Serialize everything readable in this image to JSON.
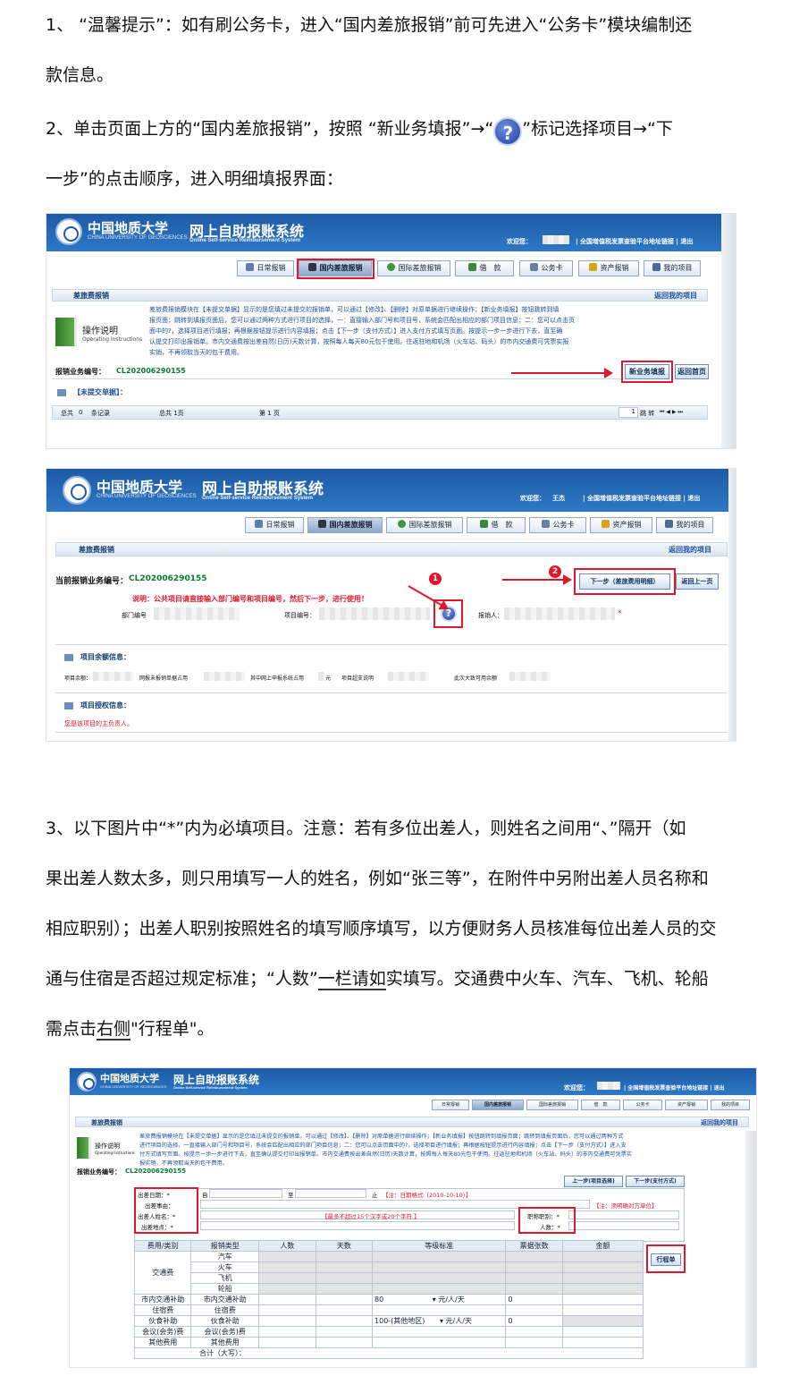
{
  "paragraphs": {
    "p1_line1": "1、  “温馨提示”：如有刷公务卡，进入“国内差旅报销”前可先进入“公务卡”模块编制还",
    "p1_line2": "款信息。",
    "p2_part1": "2、单击页面上方的“国内差旅报销”，按照  “新业务填报”→“",
    "p2_icon": "?",
    "p2_part2": "”标记选择项目→“下",
    "p2_line2": "一步”的点击顺序，进入明细填报界面：",
    "p3_line1": "3、以下图片中“*”内为必填项目。注意：若有多位出差人，则姓名之间用“、”隔开（如",
    "p3_line2": "果出差人数太多，则只用填写一人的姓名，例如“张三等”，在附件中另附出差人员名称和",
    "p3_line3": "相应职别）；出差人职别按照姓名的填写顺序填写，以方便财务人员核准每位出差人员的交",
    "p3_line4_a": "通与住宿是否超过规定标准；“人数”",
    "p3_line4_b": "一栏请如",
    "p3_line4_c": "实填写。交通费中火车、汽车、飞机、轮船",
    "p3_line5_a": "需点击",
    "p3_line5_b": "右侧",
    "p3_line5_c": "\"行程单\"。"
  },
  "header": {
    "univ_cn": "中国地质大学",
    "univ_en": "CHINA UNIVERSITY OF GEOSCIENCES",
    "univ_en_sub": "北京 · BEIJING",
    "system_title": "网上自助报账系统",
    "system_subtitle": "Online Self-service Reimbursement System",
    "welcome": "欢迎您：",
    "welcome_name_2": "王杰",
    "invoice_link": "| 全国增值税发票查验平台地址链接 | 退出"
  },
  "nav": {
    "items": [
      "日常报销",
      "国内差旅报销",
      "国际差旅报销",
      "借　款",
      "公务卡",
      "资产报销",
      "我的项目"
    ]
  },
  "shot1": {
    "section_title": "差旅费报销",
    "return_my_projects": "返回我的项目",
    "op_title": "操作说明",
    "op_title_en": "Operating Instructions",
    "desc_a": "差旅费报销模块在【未提交单据】显示的是您填过未提交的报销单，可以通过【修改】、【删除】对原单据进行继续操作；【新业务填报】按钮跳转到填",
    "desc_b": "报页面；跳转到填报页面后，您可以通过两种方式进行项目的选择，一：直接输入部门号和项目号，系统会匹配出相应的部门项目信息；二：您可以点击页",
    "desc_c": "面中的?，选择项目进行填报；再根据按钮提示进行内容填报；点击【下一步（支付方式）】进入支付方式填写页面。按提示一步一步进行下去，直至确",
    "desc_d": "认提交打印出报销单。市内交通费按出差自然(日历)天数计算，按照每人每天80元包干使用。往返驻地和机场（火车站、码头）的市内交通费可凭票实报",
    "desc_e": "实销，不再领取当天的包干费用。",
    "biz_no_label": "报销业务编号：",
    "biz_no": "CL202006290155",
    "btn_new": "新业务填报",
    "btn_home": "返回首页",
    "unsubmitted": "【未提交单据】：",
    "total_label": "总共",
    "total_count": "0",
    "records": "条记录",
    "total_pages": "总共  1页",
    "page_no": "第 1 页",
    "page_input": "1",
    "jump": "跳 转",
    "pager": "⏮ ◀ ▶ ⏭"
  },
  "shot2": {
    "section_title": "差旅费报销",
    "return_my_projects": "返回我的项目",
    "cur_no_label": "当前报销业务编号：",
    "cur_no": "CL202006290155",
    "note": "说明：公共项目请直接输入部门编号和项目编号，然后下一步，进行使用！",
    "dept_no": "部门编号",
    "proj_no": "项目编号：",
    "reporter": "报销人：",
    "star": "*",
    "btn_next": "下一步（差旅费用明细）",
    "btn_back": "返回上一页",
    "n1": "1",
    "n2": "2",
    "help": "?",
    "proj_balance": "项目余额信息：",
    "bal_row": [
      "项目余额：",
      "网报未报销单据占用",
      "其中网上申报系统占用",
      "元",
      "项目超支说明",
      "此次大致可用余额"
    ],
    "proj_auth": "项目授权信息：",
    "auth_text": "您是该项目的主负责人。"
  },
  "shot3": {
    "section_title": "差旅费报销",
    "return_my_projects": "返回我的项目",
    "op_title": "操作说明",
    "op_title_en": "Operating Instructions",
    "desc_a": "差旅费报销模块在【未提交单据】显示的是您填过未提交的报销单，可以通过【修改】、【删除】对原单据进行继续操作；【新业务填报】按钮跳转到填报页面；跳转到填报页面后，您可以通过两种方式",
    "desc_b": "进行项目的选择，一直接输入部门号和项目号，系统会匹配出相应的部门项目信息；二：您可以点击页面中的?，选择项目进行填报；再根据按钮提示进行内容填报；点击【下一步（支付方式）】进入支",
    "desc_c": "付方式填写页面。按提示一步一步进行下去，直至确认提交打印出报销单。市内交通费按出差自然(日历)天数计算，按照每人每天80元包干使用。往返驻地和机场（火车站、码头）的市内交通费可凭票实",
    "desc_d": "报实销，不再领取当天的包干费用。",
    "biz_no_label": "报销业务编号：",
    "biz_no": "CL202006290155",
    "btn_prev": "上一步(项目选择)",
    "btn_next": "下一步(支付方式)",
    "date_label": "出差日期：*",
    "from": "自",
    "to": "至",
    "until": "止",
    "date_note": "【注：日期格式（2010-10-10）】",
    "reason_label": "出差事由：",
    "reason_note": "【注：须明确对方单位】",
    "name_label": "出差人姓名：*",
    "name_note": "【最多不超过15个汉字或20个字符 】",
    "rank_label": "职称职别：*",
    "place_label": "出差地点：*",
    "count_label": "人数：*",
    "cols": [
      "费用/类别",
      "报销类型",
      "人数",
      "天数",
      "等级标准",
      "票据张数",
      "金额"
    ],
    "traffic": "交通费",
    "traffic_types": [
      "汽车",
      "火车",
      "飞机",
      "轮船"
    ],
    "city_traffic": "市内交通补助",
    "city_traffic_type": "市内交通补助",
    "city_std": "80",
    "per_unit": "元/人/天",
    "zero": "0",
    "lodging": "住宿费",
    "lodging_type": "住宿费",
    "meal": "伙食补助",
    "meal_type": "伙食补助",
    "meal_std": "100-(其他地区)",
    "meeting": "会议(会务)费",
    "meeting_type": "会议(会务)费",
    "other": "其他费用",
    "other_type": "其他费用",
    "total": "合计（大写）：",
    "btn_itinerary": "行程单"
  }
}
